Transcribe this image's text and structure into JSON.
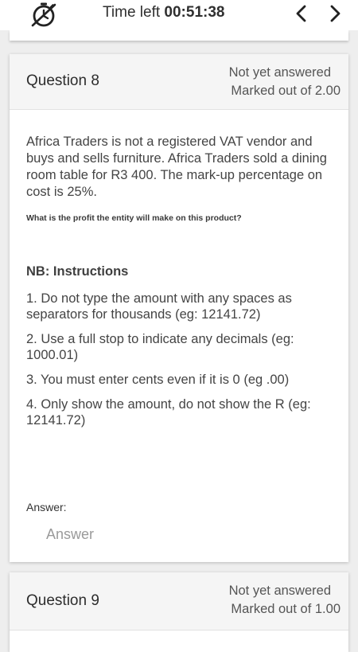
{
  "topbar": {
    "timer_icon": "stopwatch-icon",
    "time_left_label": "Time left ",
    "time_left_value": "00:51:38",
    "prev_icon": "chevron-left-icon",
    "next_icon": "chevron-right-icon"
  },
  "questions": [
    {
      "label": "Question 8",
      "status": "Not yet answered",
      "marks": "Marked out of 2.00",
      "text": "Africa Traders is not a registered VAT vendor and buys and sells furniture. Africa Traders sold a dining room table for R3 400. The mark-up percentage on cost is 25%.",
      "prompt": "What is the profit the entity will make on this product?",
      "nb_heading": "NB: Instructions",
      "instructions": [
        "1. Do not type the amount with any spaces as separators for thousands (eg: 12141.72)",
        "2. Use a full stop to indicate any decimals (eg: 1000.01)",
        "3. You must enter cents even if it is 0 (eg .00)",
        "4. Only show the amount, do not show the R (eg: 12141.72)"
      ],
      "answer_label": "Answer:",
      "answer_value": "",
      "answer_placeholder": "Answer"
    },
    {
      "label": "Question 9",
      "status": "Not yet answered",
      "marks": "Marked out of 1.00"
    }
  ],
  "colors": {
    "background": "#eeeeee",
    "card": "#ffffff",
    "card_header": "#f5f5f5",
    "text": "#333333",
    "muted": "#555555"
  }
}
